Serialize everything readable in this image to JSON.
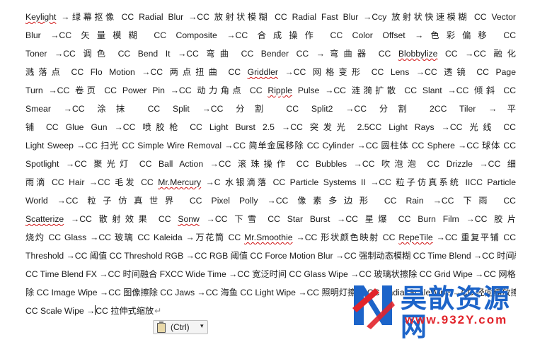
{
  "document": {
    "lines": [
      [
        {
          "t": "Keylight",
          "s": 1
        },
        {
          "t": " →绿幕抠像 CC Radial Blur →CC 放射状模糊 CC Radial Fast Blur →Ccy 放射状快速模糊 CC Vector"
        }
      ],
      [
        {
          "t": "Blur →CC 矢量模糊 CC Composite →CC 合成操作 CC Color Offset →色彩偏移 CC"
        }
      ],
      [
        {
          "t": "Toner →CC 调色 CC Bend It →CC 弯曲 CC Bender CC →弯曲器 CC "
        },
        {
          "t": "Blobbylize",
          "s": 1
        },
        {
          "t": " CC →CC 融化"
        }
      ],
      [
        {
          "t": "溅落点 CC Flo Motion →CC 两点扭曲 CC "
        },
        {
          "t": "Griddler",
          "s": 1
        },
        {
          "t": " →CC 网格变形 CC Lens →CC 透镜 CC Page"
        }
      ],
      [
        {
          "t": "Turn →CC 卷页 CC Power Pin →CC 动力角点 CC "
        },
        {
          "t": "Ripple",
          "s": 1
        },
        {
          "t": " Pulse →CC 涟漪扩散 CC Slant →CC 倾斜 CC"
        }
      ],
      [
        {
          "t": "Smear →CC 涂抹 CC Split →CC 分割 CC Split2 →CC 分割 2CC Tiler →平"
        }
      ],
      [
        {
          "t": "铺 CC Glue Gun →CC 喷胶枪 CC Light Burst 2.5 →CC 突发光 2.5CC Light Rays →CC 光线 CC"
        }
      ],
      [
        {
          "t": "Light Sweep →CC 扫光 CC Simple Wire Removal →CC 简单金属移除 CC Cylinder →CC 圆柱体 CC Sphere →CC 球体 CC"
        }
      ],
      [
        {
          "t": "Spotlight →CC 聚光灯 CC Ball Action →CC 滚珠操作 CC Bubbles →CC 吹泡泡 CC Drizzle →CC 细"
        }
      ],
      [
        {
          "t": "雨滴 CC Hair →CC 毛发 CC "
        },
        {
          "t": "Mr.Mercury",
          "s": 1
        },
        {
          "t": " →C 水银滴落 CC Particle Systems II →CC 粒子仿真系统 IICC Particle"
        }
      ],
      [
        {
          "t": "World →CC 粒子仿真世界 CC Pixel Polly →CC 像素多边形 CC Rain →CC 下雨 CC"
        }
      ],
      [
        {
          "t": "Scatterize",
          "s": 1
        },
        {
          "t": " →CC 散射效果 CC "
        },
        {
          "t": "Sonw",
          "s": 1
        },
        {
          "t": " →CC 下雪 CC Star Burst →CC 星爆 CC Burn Film →CC 胶片"
        }
      ],
      [
        {
          "t": "烧灼 CC Glass →CC 玻璃 CC Kaleida →万花筒 CC "
        },
        {
          "t": "Mr.Smoothie",
          "s": 1
        },
        {
          "t": " →CC 形状颜色映射 CC "
        },
        {
          "t": "RepeTile",
          "s": 1
        },
        {
          "t": " →CC 重复平铺 CC"
        }
      ],
      [
        {
          "t": "Threshold →CC 阈值 CC Threshold RGB →CC RGB 阈值 CC Force Motion Blur →CC 强制动态模糊 CC Time Blend →CC 时间融合"
        }
      ],
      [
        {
          "t": "CC Time Blend FX →CC 时间融合 FXCC Wide Time →CC 宽泛时间 CC Glass Wipe →CC 玻璃状擦除 CC Grid Wipe →CC 网格擦"
        }
      ],
      [
        {
          "t": "除 CC Image Wipe →CC 图像擦除 CC Jaws →CC 海鱼 CC Light Wipe →CC 照明灯擦除 CC Radial ScaleWipe →CC 径向缩放擦除"
        }
      ],
      [
        {
          "t": "CC Scale Wipe →"
        },
        {
          "t": "",
          "caret": 1
        },
        {
          "t": "CC 拉伸式缩放"
        },
        {
          "t": "↵",
          "pm": 1
        }
      ]
    ]
  },
  "paste_options": {
    "label": "(Ctrl)",
    "arrow": "▾",
    "icon": "clipboard-icon"
  },
  "watermark": {
    "logo_text": "N",
    "title": "昊歆资源网",
    "url": "www.932Y.com",
    "colors": {
      "blue": "#1c64c9",
      "red": "#e2242b"
    }
  }
}
